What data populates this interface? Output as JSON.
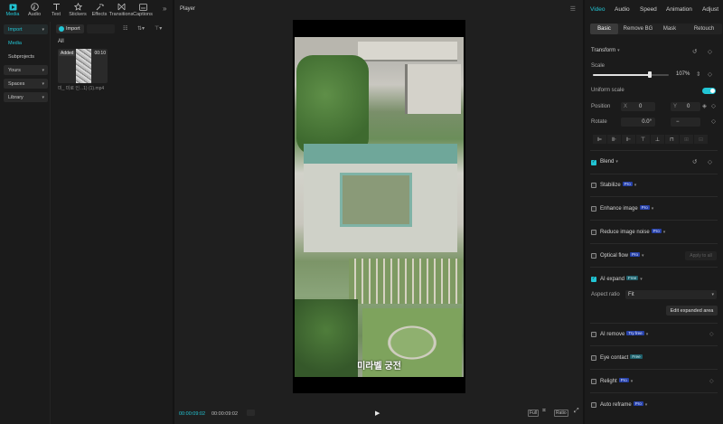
{
  "top_tabs": [
    {
      "label": "Media",
      "icon": "media-icon",
      "active": true
    },
    {
      "label": "Audio",
      "icon": "audio-icon"
    },
    {
      "label": "Text",
      "icon": "text-icon"
    },
    {
      "label": "Stickers",
      "icon": "stickers-icon"
    },
    {
      "label": "Effects",
      "icon": "effects-icon"
    },
    {
      "label": "Transitions",
      "icon": "transitions-icon"
    },
    {
      "label": "Captions",
      "icon": "captions-icon"
    }
  ],
  "left_nav": {
    "import": "Import",
    "media": "Media",
    "subprojects": "Subprojects",
    "yours": "Yours",
    "spaces": "Spaces",
    "library": "Library"
  },
  "media_panel": {
    "import_button": "Import",
    "all_label": "All",
    "clip": {
      "badge": "Added",
      "duration": "00:10",
      "name": "미_ 미로 인...1) (1).mp4"
    }
  },
  "player": {
    "title": "Player",
    "caption": "미라벨 궁전",
    "current_time": "00:00:09:02",
    "total_time": "00:00:09:02",
    "buttons": {
      "full": "Full",
      "ratio": "Ratio"
    }
  },
  "right_tabs": [
    "Video",
    "Audio",
    "Speed",
    "Animation",
    "Adjust"
  ],
  "sub_tabs": [
    "Basic",
    "Remove BG",
    "Mask",
    "Retouch"
  ],
  "transform": {
    "title": "Transform",
    "scale_label": "Scale",
    "scale_value": "107%",
    "scale_fraction": 0.75,
    "uniform_scale": "Uniform scale",
    "position_label": "Position",
    "pos_x_tag": "X",
    "pos_x": "0",
    "pos_y_tag": "Y",
    "pos_y": "0",
    "rotate_label": "Rotate",
    "rotate_value": "0.0°",
    "rotate_extra": "−"
  },
  "sections": {
    "blend": "Blend",
    "stabilize": "Stabilize",
    "enhance_image": "Enhance image",
    "reduce_noise": "Reduce image noise",
    "optical_flow": "Optical flow",
    "ai_expand": "AI expand",
    "aspect_ratio_label": "Aspect ratio",
    "aspect_ratio_value": "Fit",
    "edit_expanded": "Edit expanded area",
    "ai_remove": "AI remove",
    "eye_contact": "Eye contact",
    "relight": "Relight",
    "auto_reframe": "Auto reframe",
    "apply_all": "Apply to all"
  },
  "badges": {
    "pro": "Pro",
    "free": "Free",
    "try_free": "Try free"
  },
  "colors": {
    "accent": "#22c5d4",
    "pro_badge": "#2741a8"
  }
}
